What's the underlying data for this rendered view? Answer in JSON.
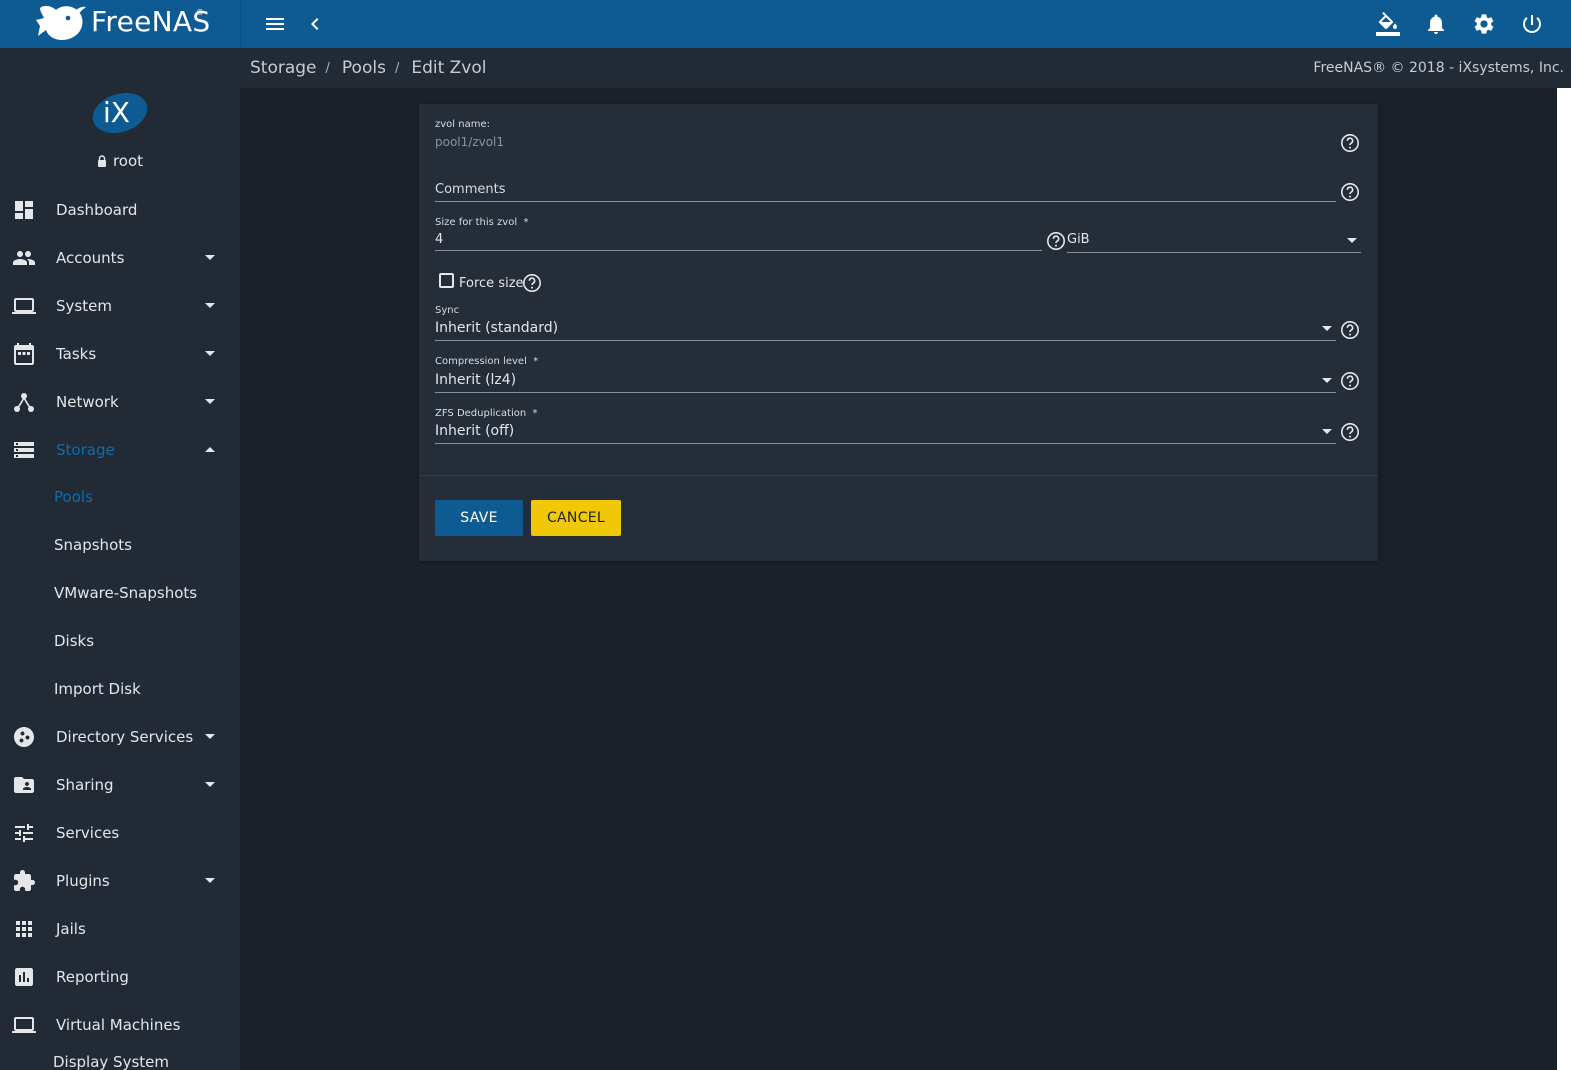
{
  "topbar": {
    "brand": "FreeNAS",
    "brand_tm": "®"
  },
  "sidebar": {
    "user": "root",
    "items": [
      {
        "label": "Dashboard",
        "icon": "dashboard-icon"
      },
      {
        "label": "Accounts",
        "icon": "people-icon"
      },
      {
        "label": "System",
        "icon": "laptop-icon"
      },
      {
        "label": "Tasks",
        "icon": "calendar-icon"
      },
      {
        "label": "Network",
        "icon": "network-icon"
      },
      {
        "label": "Storage",
        "icon": "storage-icon"
      },
      {
        "label": "Directory Services",
        "icon": "directory-icon"
      },
      {
        "label": "Sharing",
        "icon": "shared-folder-icon"
      },
      {
        "label": "Services",
        "icon": "tune-icon"
      },
      {
        "label": "Plugins",
        "icon": "extension-icon"
      },
      {
        "label": "Jails",
        "icon": "apps-grid-icon"
      },
      {
        "label": "Reporting",
        "icon": "chart-icon"
      },
      {
        "label": "Virtual Machines",
        "icon": "laptop-icon"
      },
      {
        "label": "Display System"
      }
    ],
    "storage_sub": [
      "Pools",
      "Snapshots",
      "VMware-Snapshots",
      "Disks",
      "Import Disk"
    ]
  },
  "breadcrumb": {
    "items": [
      "Storage",
      "Pools",
      "Edit Zvol"
    ],
    "sep": "/"
  },
  "copyright": "FreeNAS® © 2018 - iXsystems, Inc.",
  "form": {
    "zvol_name": {
      "label": "zvol name:",
      "value": "pool1/zvol1"
    },
    "comments": {
      "placeholder": "Comments",
      "value": ""
    },
    "size": {
      "label": "Size for this zvol",
      "required": "*",
      "value": "4",
      "unit": "GiB"
    },
    "force_size": {
      "label": "Force size",
      "checked": false
    },
    "sync": {
      "label": "Sync",
      "value": "Inherit (standard)"
    },
    "compression": {
      "label": "Compression level",
      "required": "*",
      "value": "Inherit (lz4)"
    },
    "dedup": {
      "label": "ZFS Deduplication",
      "required": "*",
      "value": "Inherit (off)"
    },
    "save_label": "SAVE",
    "cancel_label": "CANCEL"
  },
  "colors": {
    "topbar": "#0e5b94",
    "sidebar": "#222a35",
    "content_bg": "#1b2029",
    "card": "#242d38",
    "active_nav": "#0e6cb0",
    "save": "#0e5b94",
    "cancel": "#f0c808"
  }
}
